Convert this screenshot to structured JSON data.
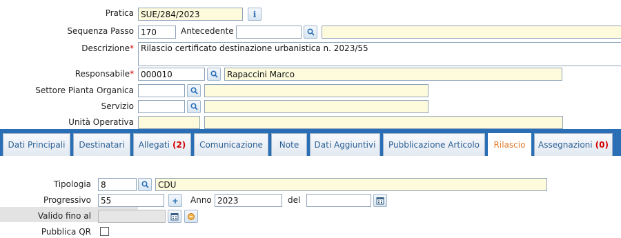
{
  "header": {
    "pratica": {
      "label": "Pratica",
      "value": "SUE/284/2023"
    },
    "sequenza": {
      "label": "Sequenza Passo",
      "value": "170"
    },
    "antecedente": {
      "label": "Antecedente",
      "value": "",
      "desc": ""
    },
    "descrizione": {
      "label": "Descrizione",
      "required": "*",
      "value": "Rilascio certificato destinazione urbanistica n. 2023/55"
    },
    "responsabile": {
      "label": "Responsabile",
      "required": "*",
      "code": "000010",
      "name": "Rapaccini Marco"
    },
    "settore": {
      "label": "Settore Pianta Organica",
      "code": "",
      "desc": ""
    },
    "servizio": {
      "label": "Servizio",
      "code": "",
      "desc": ""
    },
    "unita": {
      "label": "Unità Operativa",
      "code": "",
      "desc": ""
    }
  },
  "tabs": [
    {
      "label": "Dati Principali",
      "count": ""
    },
    {
      "label": "Destinatari",
      "count": ""
    },
    {
      "label": "Allegati",
      "count": "(2)"
    },
    {
      "label": "Comunicazione",
      "count": ""
    },
    {
      "label": "Note",
      "count": ""
    },
    {
      "label": "Dati Aggiuntivi",
      "count": ""
    },
    {
      "label": "Pubblicazione Articolo",
      "count": ""
    },
    {
      "label": "Rilascio",
      "count": "",
      "active": true
    },
    {
      "label": "Assegnazioni",
      "count": "(0)"
    }
  ],
  "rilascio": {
    "tipologia": {
      "label": "Tipologia",
      "code": "8",
      "desc": "CDU"
    },
    "progressivo": {
      "label": "Progressivo",
      "value": "55"
    },
    "anno": {
      "label": "Anno",
      "value": "2023"
    },
    "del": {
      "label": "del",
      "value": ""
    },
    "valido": {
      "label": "Valido fino al",
      "value": ""
    },
    "pubblica_qr": {
      "label": "Pubblica QR",
      "checked": false
    }
  },
  "colors": {
    "tabbar": "#2a6fb6",
    "active_tab_text": "#e07b2c",
    "readonly_bg": "#fdfbdc",
    "required": "#d40000"
  }
}
